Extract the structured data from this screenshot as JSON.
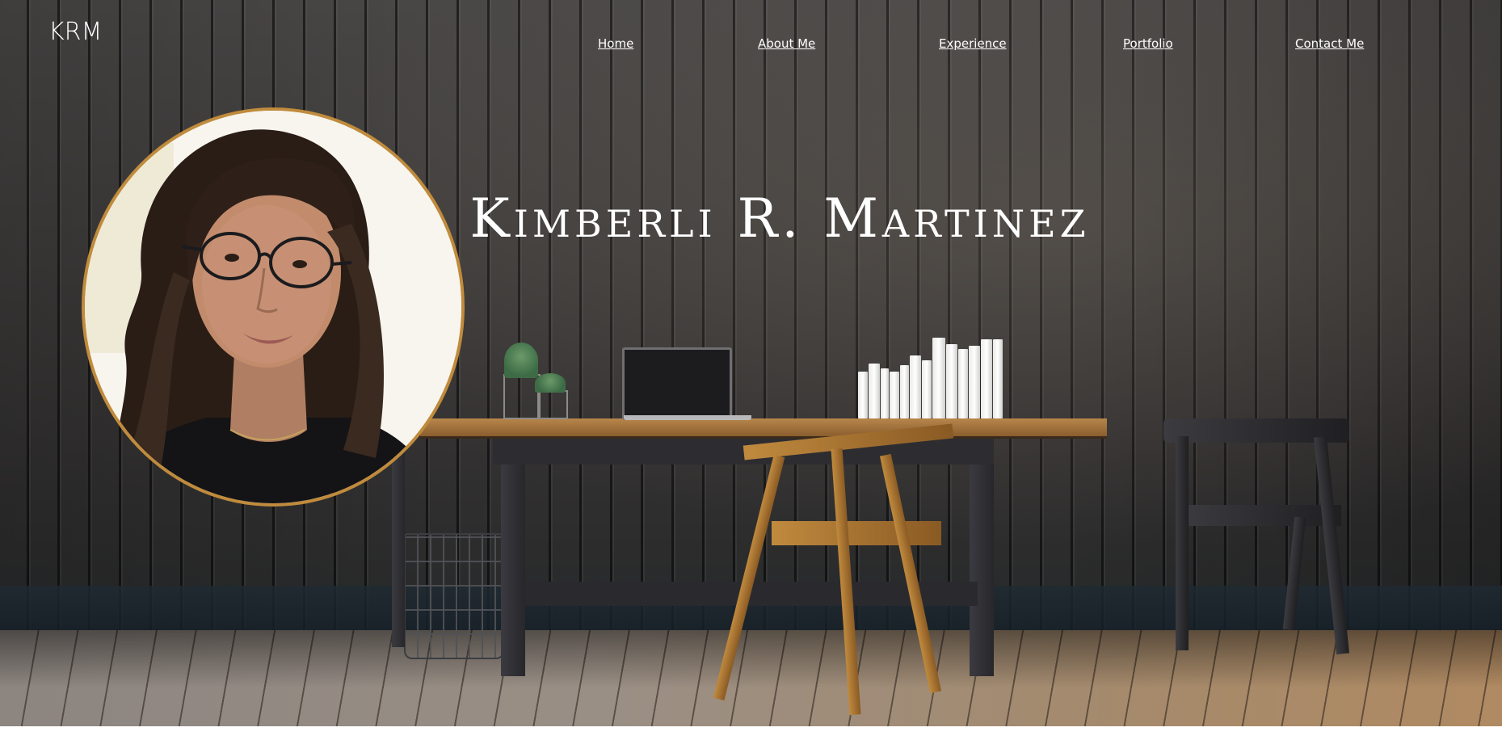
{
  "header": {
    "logo": "KRM"
  },
  "nav": {
    "items": [
      {
        "label": "Home"
      },
      {
        "label": "About Me"
      },
      {
        "label": "Experience"
      },
      {
        "label": "Portfolio"
      },
      {
        "label": "Contact Me"
      }
    ]
  },
  "hero": {
    "title": "Kimberli R. Martinez"
  },
  "colors": {
    "accent": "#c08b3c",
    "text": "#ffffff",
    "wall": "#3e3c3b",
    "floor": "#9a8f85"
  }
}
